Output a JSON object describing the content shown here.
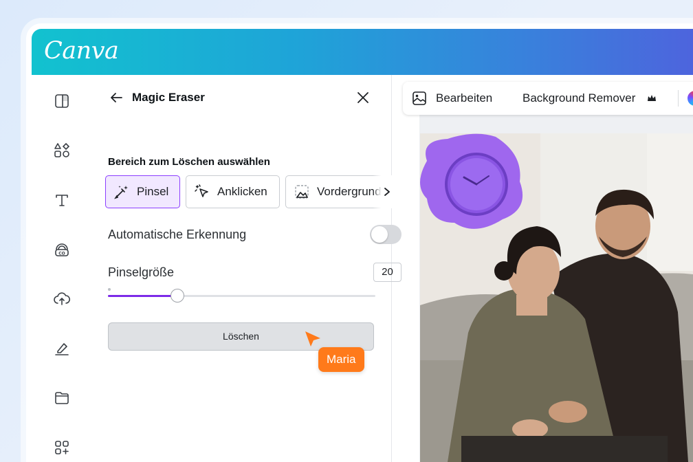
{
  "app": {
    "logo": "Canva"
  },
  "sidebar": {
    "icons": [
      "layout-icon",
      "elements-icon",
      "text-icon",
      "brand-icon",
      "upload-icon",
      "draw-icon",
      "folder-icon",
      "apps-icon"
    ]
  },
  "panel": {
    "title": "Magic Eraser",
    "section_label": "Bereich zum Löschen auswählen",
    "modes": [
      {
        "label": "Pinsel",
        "active": true
      },
      {
        "label": "Anklicken",
        "active": false
      },
      {
        "label": "Vordergrund",
        "active": false
      }
    ],
    "auto_detect_label": "Automatische Erkennung",
    "auto_detect_on": false,
    "brush_size_label": "Pinselgröße",
    "brush_size_value": "20",
    "brush_size_fraction": 0.26,
    "erase_button": "Löschen"
  },
  "collaborator": {
    "name": "Maria",
    "color": "#ff7a1a"
  },
  "toolbar": {
    "edit_label": "Bearbeiten",
    "bg_remover_label": "Background Remover"
  },
  "colors": {
    "accent": "#8b3dff",
    "brand_start": "#12c2cf",
    "brand_end": "#4f62dd"
  }
}
